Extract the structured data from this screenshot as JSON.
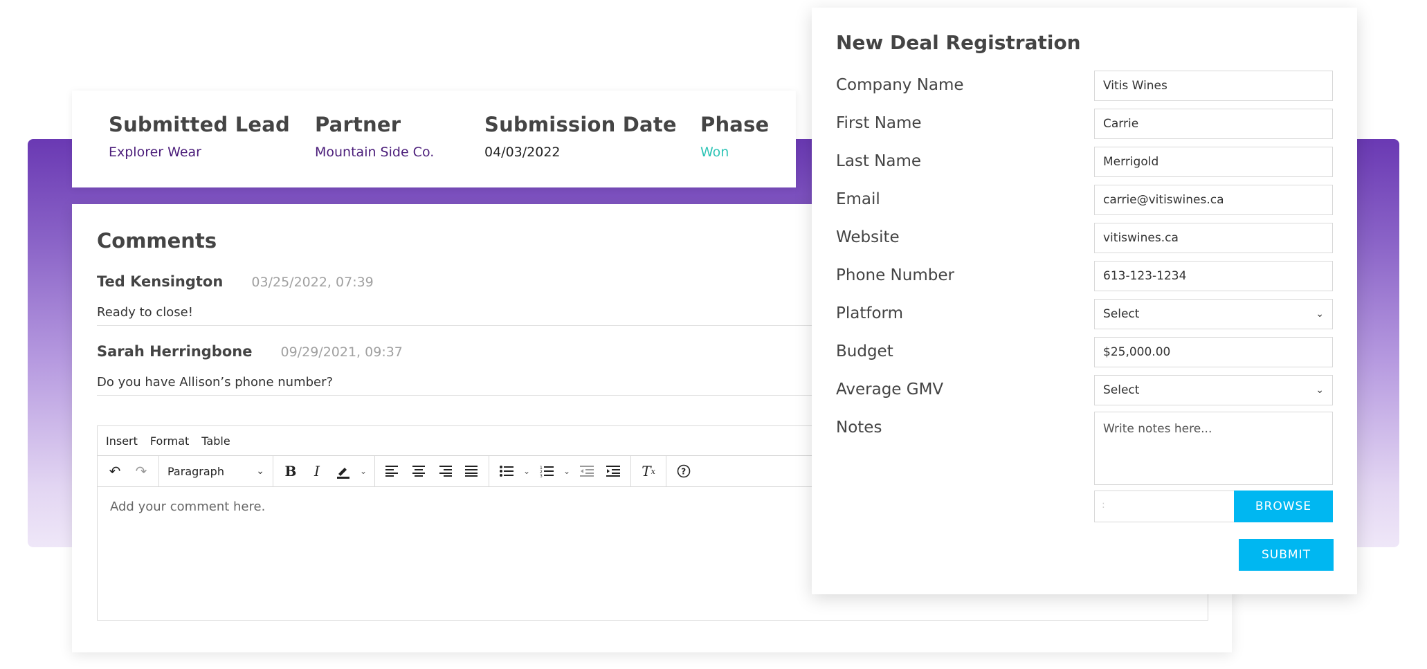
{
  "lead": {
    "submitted_lead_label": "Submitted Lead",
    "submitted_lead_value": "Explorer Wear",
    "partner_label": "Partner",
    "partner_value": "Mountain Side Co.",
    "date_label": "Submission Date",
    "date_value": "04/03/2022",
    "phase_label": "Phase",
    "phase_value": "Won"
  },
  "comments": {
    "title": "Comments",
    "items": [
      {
        "author": "Ted Kensington",
        "time": "03/25/2022, 07:39",
        "body": "Ready to close!"
      },
      {
        "author": "Sarah Herringbone",
        "time": "09/29/2021, 09:37",
        "body": "Do you have Allison’s phone number?"
      }
    ]
  },
  "editor": {
    "menu": [
      "Insert",
      "Format",
      "Table"
    ],
    "paragraph_label": "Paragraph",
    "placeholder": "Add your comment here."
  },
  "deal": {
    "title": "New Deal Registration",
    "fields": [
      {
        "label": "Company Name",
        "value": "Vitis Wines"
      },
      {
        "label": "First Name",
        "value": "Carrie"
      },
      {
        "label": "Last Name",
        "value": "Merrigold"
      },
      {
        "label": "Email",
        "value": "carrie@vitiswines.ca"
      },
      {
        "label": "Website",
        "value": "vitiswines.ca"
      },
      {
        "label": "Phone Number",
        "value": "613-123-1234"
      },
      {
        "label": "Platform",
        "value": "Select"
      },
      {
        "label": "Budget",
        "value": "$25,000.00"
      },
      {
        "label": "Average GMV",
        "value": "Select"
      },
      {
        "label": "Notes",
        "value": "Write notes here..."
      }
    ],
    "file_placeholder": ":",
    "browse_label": "BROWSE",
    "submit_label": "SUBMIT"
  },
  "colors": {
    "accent_purple": "#6a39b3",
    "lead_value_purple": "#4b1d7a",
    "phase_teal": "#2ec4b6",
    "button_blue": "#00b7f1"
  }
}
